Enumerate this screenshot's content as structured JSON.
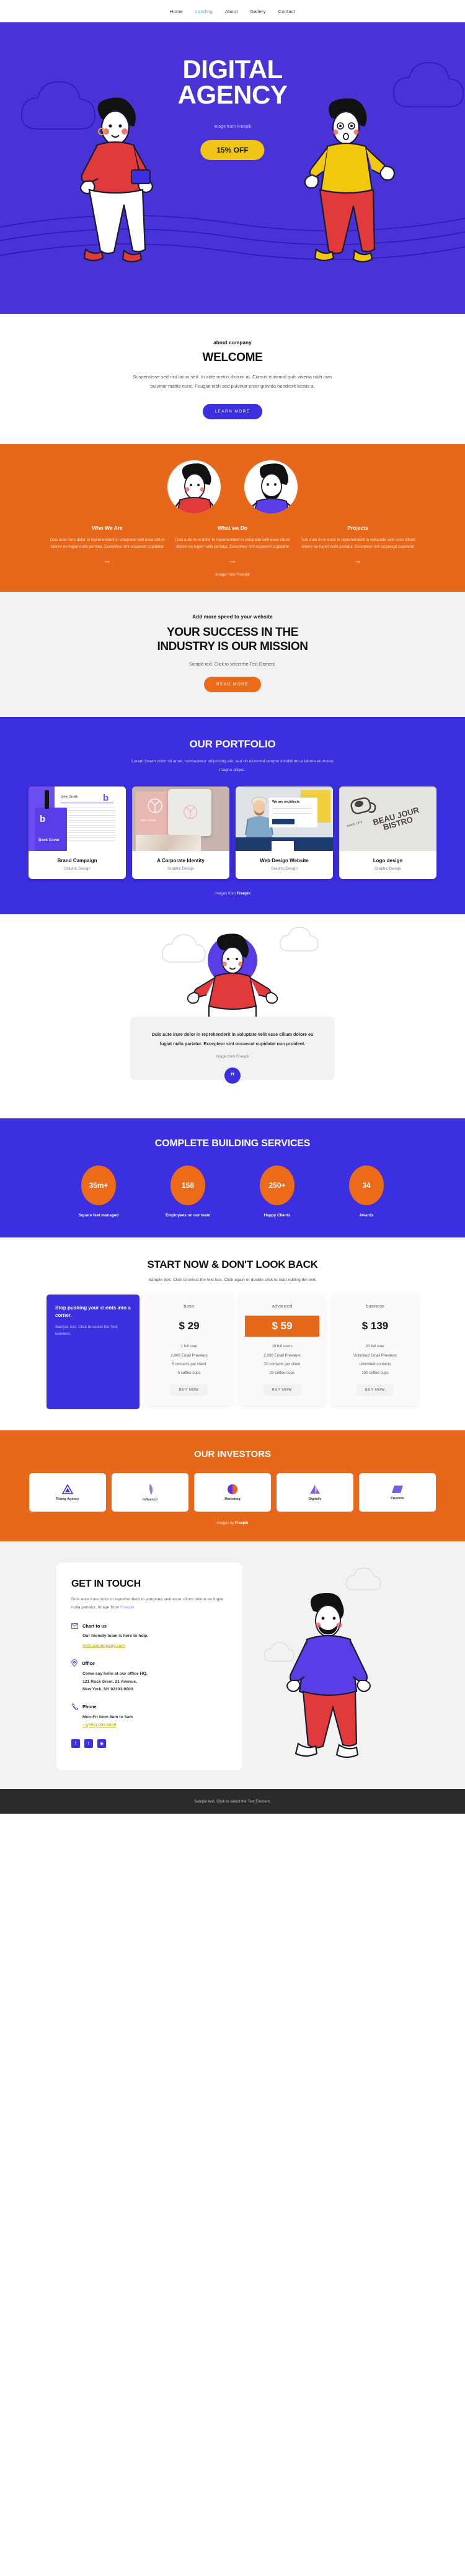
{
  "nav": {
    "items": [
      {
        "label": "Home",
        "active": false
      },
      {
        "label": "Landing",
        "active": true
      },
      {
        "label": "About",
        "active": false
      },
      {
        "label": "Gallery",
        "active": false
      },
      {
        "label": "Contact",
        "active": false
      }
    ]
  },
  "hero": {
    "title_line1": "DIGITAL",
    "title_line2": "AGENCY",
    "credit": "Image from Freepik",
    "offer_label": "15% OFF",
    "bg_color": "#4733d6",
    "offer_color": "#f0c515"
  },
  "welcome": {
    "eyebrow": "about company",
    "title": "WELCOME",
    "body": "Suspendisse sed nisi lacus sed. In ante metus dictum at. Cursus euismod quis viverra nibh cras pulvinar mattis nunc. Feugiat nibh sed pulvinar proin gravida hendrerit lectus a.",
    "cta": "LEARN MORE"
  },
  "services": {
    "bg_color": "#e8681b",
    "credit": "Image from Freepik",
    "columns": [
      {
        "title": "Who We Are",
        "body": "Duis aute irure dolor in reprehenderit in voluptate velit esse cillum dolore eu fugiat nulla pariatur. Excepteur sint occaecat cupidatat",
        "arrow": "→"
      },
      {
        "title": "What we Do",
        "body": "Duis aute irure dolor in reprehenderit in voluptate velit esse cillum dolore eu fugiat nulla pariatur. Excepteur sint occaecat cupidatat",
        "arrow": "→"
      },
      {
        "title": "Projects",
        "body": "Duis aute irure dolor in reprehenderit in voluptate velit esse cillum dolore eu fugiat nulla pariatur. Excepteur sint occaecat cupidatat",
        "arrow": "→"
      }
    ]
  },
  "mission": {
    "eyebrow": "Add more speed to your website",
    "title_line1": "YOUR SUCCESS IN THE",
    "title_line2": "INDUSTRY IS OUR MISSION",
    "sub": "Sample text. Click to select the Text Element.",
    "cta": "READ MORE"
  },
  "portfolio": {
    "title": "OUR PORTFOLIO",
    "lead": "Lorem ipsum dolor sit amet, consectetur adipiscing elit, sed do eiusmod tempor incididunt ut labore et dolore magna aliqua.",
    "credit_prefix": "Images from ",
    "credit_link": "Freepik",
    "cards": [
      {
        "title": "Brand Campaign",
        "tag": "Graphic Design",
        "thumb_label": "Book Cover",
        "thumb_name": "John Smith"
      },
      {
        "title": "A Corporate Identity",
        "tag": "Graphic Design",
        "thumb_label": "DEC VOKO",
        "thumb_name": ""
      },
      {
        "title": "Web Design Website",
        "tag": "Graphic Design",
        "thumb_label": "We are architects",
        "thumb_name": "LEARN MORE"
      },
      {
        "title": "Logo design",
        "tag": "Graphic Design",
        "thumb_label": "BEAU JOUR BISTRO",
        "thumb_name": "SINCE 1970"
      }
    ]
  },
  "quote": {
    "text": "Duis aute irure dolor in reprehenderit in voluptate velit esse cillum dolore eu fugiat nulla pariatur. Excepteur sint occaecat cupidatat non proident.",
    "credit": "Image from Freepik",
    "mark": "”"
  },
  "stats": {
    "title": "COMPLETE BUILDING SERVICES",
    "items": [
      {
        "value": "35m+",
        "label": "Square feet managed"
      },
      {
        "value": "158",
        "label": "Employees on our team"
      },
      {
        "value": "250+",
        "label": "Happy Clients"
      },
      {
        "value": "34",
        "label": "Awards"
      }
    ]
  },
  "pricing": {
    "title": "START NOW & DON'T LOOK BACK",
    "sub": "Sample text. Click to select the text box. Click again or double click to start editing the text.",
    "promo": {
      "title": "Stop pushing your clients into a corner.",
      "body": "Sample text. Click to select the Text Element."
    },
    "plans": [
      {
        "name": "basic",
        "price": "$ 29",
        "highlight": false,
        "features": [
          "1 full user",
          "1,000 Email Previews",
          "5 contacts per client",
          "5 coffee cups"
        ],
        "cta": "BUY NOW"
      },
      {
        "name": "advanced",
        "price": "$ 59",
        "highlight": true,
        "features": [
          "10 full users",
          "2,000 Email Previews",
          "20 contacts per client",
          "20 coffee cups"
        ],
        "cta": "BUY NOW"
      },
      {
        "name": "business",
        "price": "$ 139",
        "highlight": false,
        "features": [
          "20 full user",
          "Unlimited Email Previews",
          "Unlimited contacts",
          "100 coffee cups"
        ],
        "cta": "BUY NOW"
      }
    ]
  },
  "investors": {
    "title": "OUR INVESTORS",
    "credit_prefix": "Images by ",
    "credit_link": "Freepik",
    "logos": [
      {
        "name": "Rising Agency",
        "icon": "triangle-logo-icon"
      },
      {
        "name": "Influencil",
        "icon": "feather-logo-icon"
      },
      {
        "name": "Marketing",
        "icon": "circle-logo-icon"
      },
      {
        "name": "Digitally",
        "icon": "mountain-logo-icon"
      },
      {
        "name": "Promote",
        "icon": "parallelogram-logo-icon"
      }
    ]
  },
  "contact": {
    "title": "GET IN TOUCH",
    "intro_text": "Duis aute irure dolor in reprehenderit in voluptate velit esse cillum dolore eu fugiat nulla pariatur. Image from ",
    "intro_link": "Freepik",
    "blocks": [
      {
        "icon": "mail-icon",
        "heading": "Chart to us",
        "line1": "Our friendly team is here to help.",
        "link": "hi@ourcompany.com",
        "line2": "",
        "line3": ""
      },
      {
        "icon": "location-pin-icon",
        "heading": "Office",
        "line1": "Come say hello at our office HQ.",
        "link": "",
        "line2": "121 Rock Sreet, 21 Avenue,",
        "line3": "New York, NY 92103-9000"
      },
      {
        "icon": "phone-icon",
        "heading": "Phone",
        "line1": "Mon-Fri from 8am to 5am",
        "link": "+1(555) 000-0000",
        "line2": "",
        "line3": ""
      }
    ],
    "social": [
      {
        "name": "facebook-icon",
        "glyph": "f"
      },
      {
        "name": "twitter-icon",
        "glyph": "t"
      },
      {
        "name": "instagram-icon",
        "glyph": "◉"
      }
    ]
  },
  "footer": {
    "text": "Sample text. Click to select the Text Element."
  }
}
